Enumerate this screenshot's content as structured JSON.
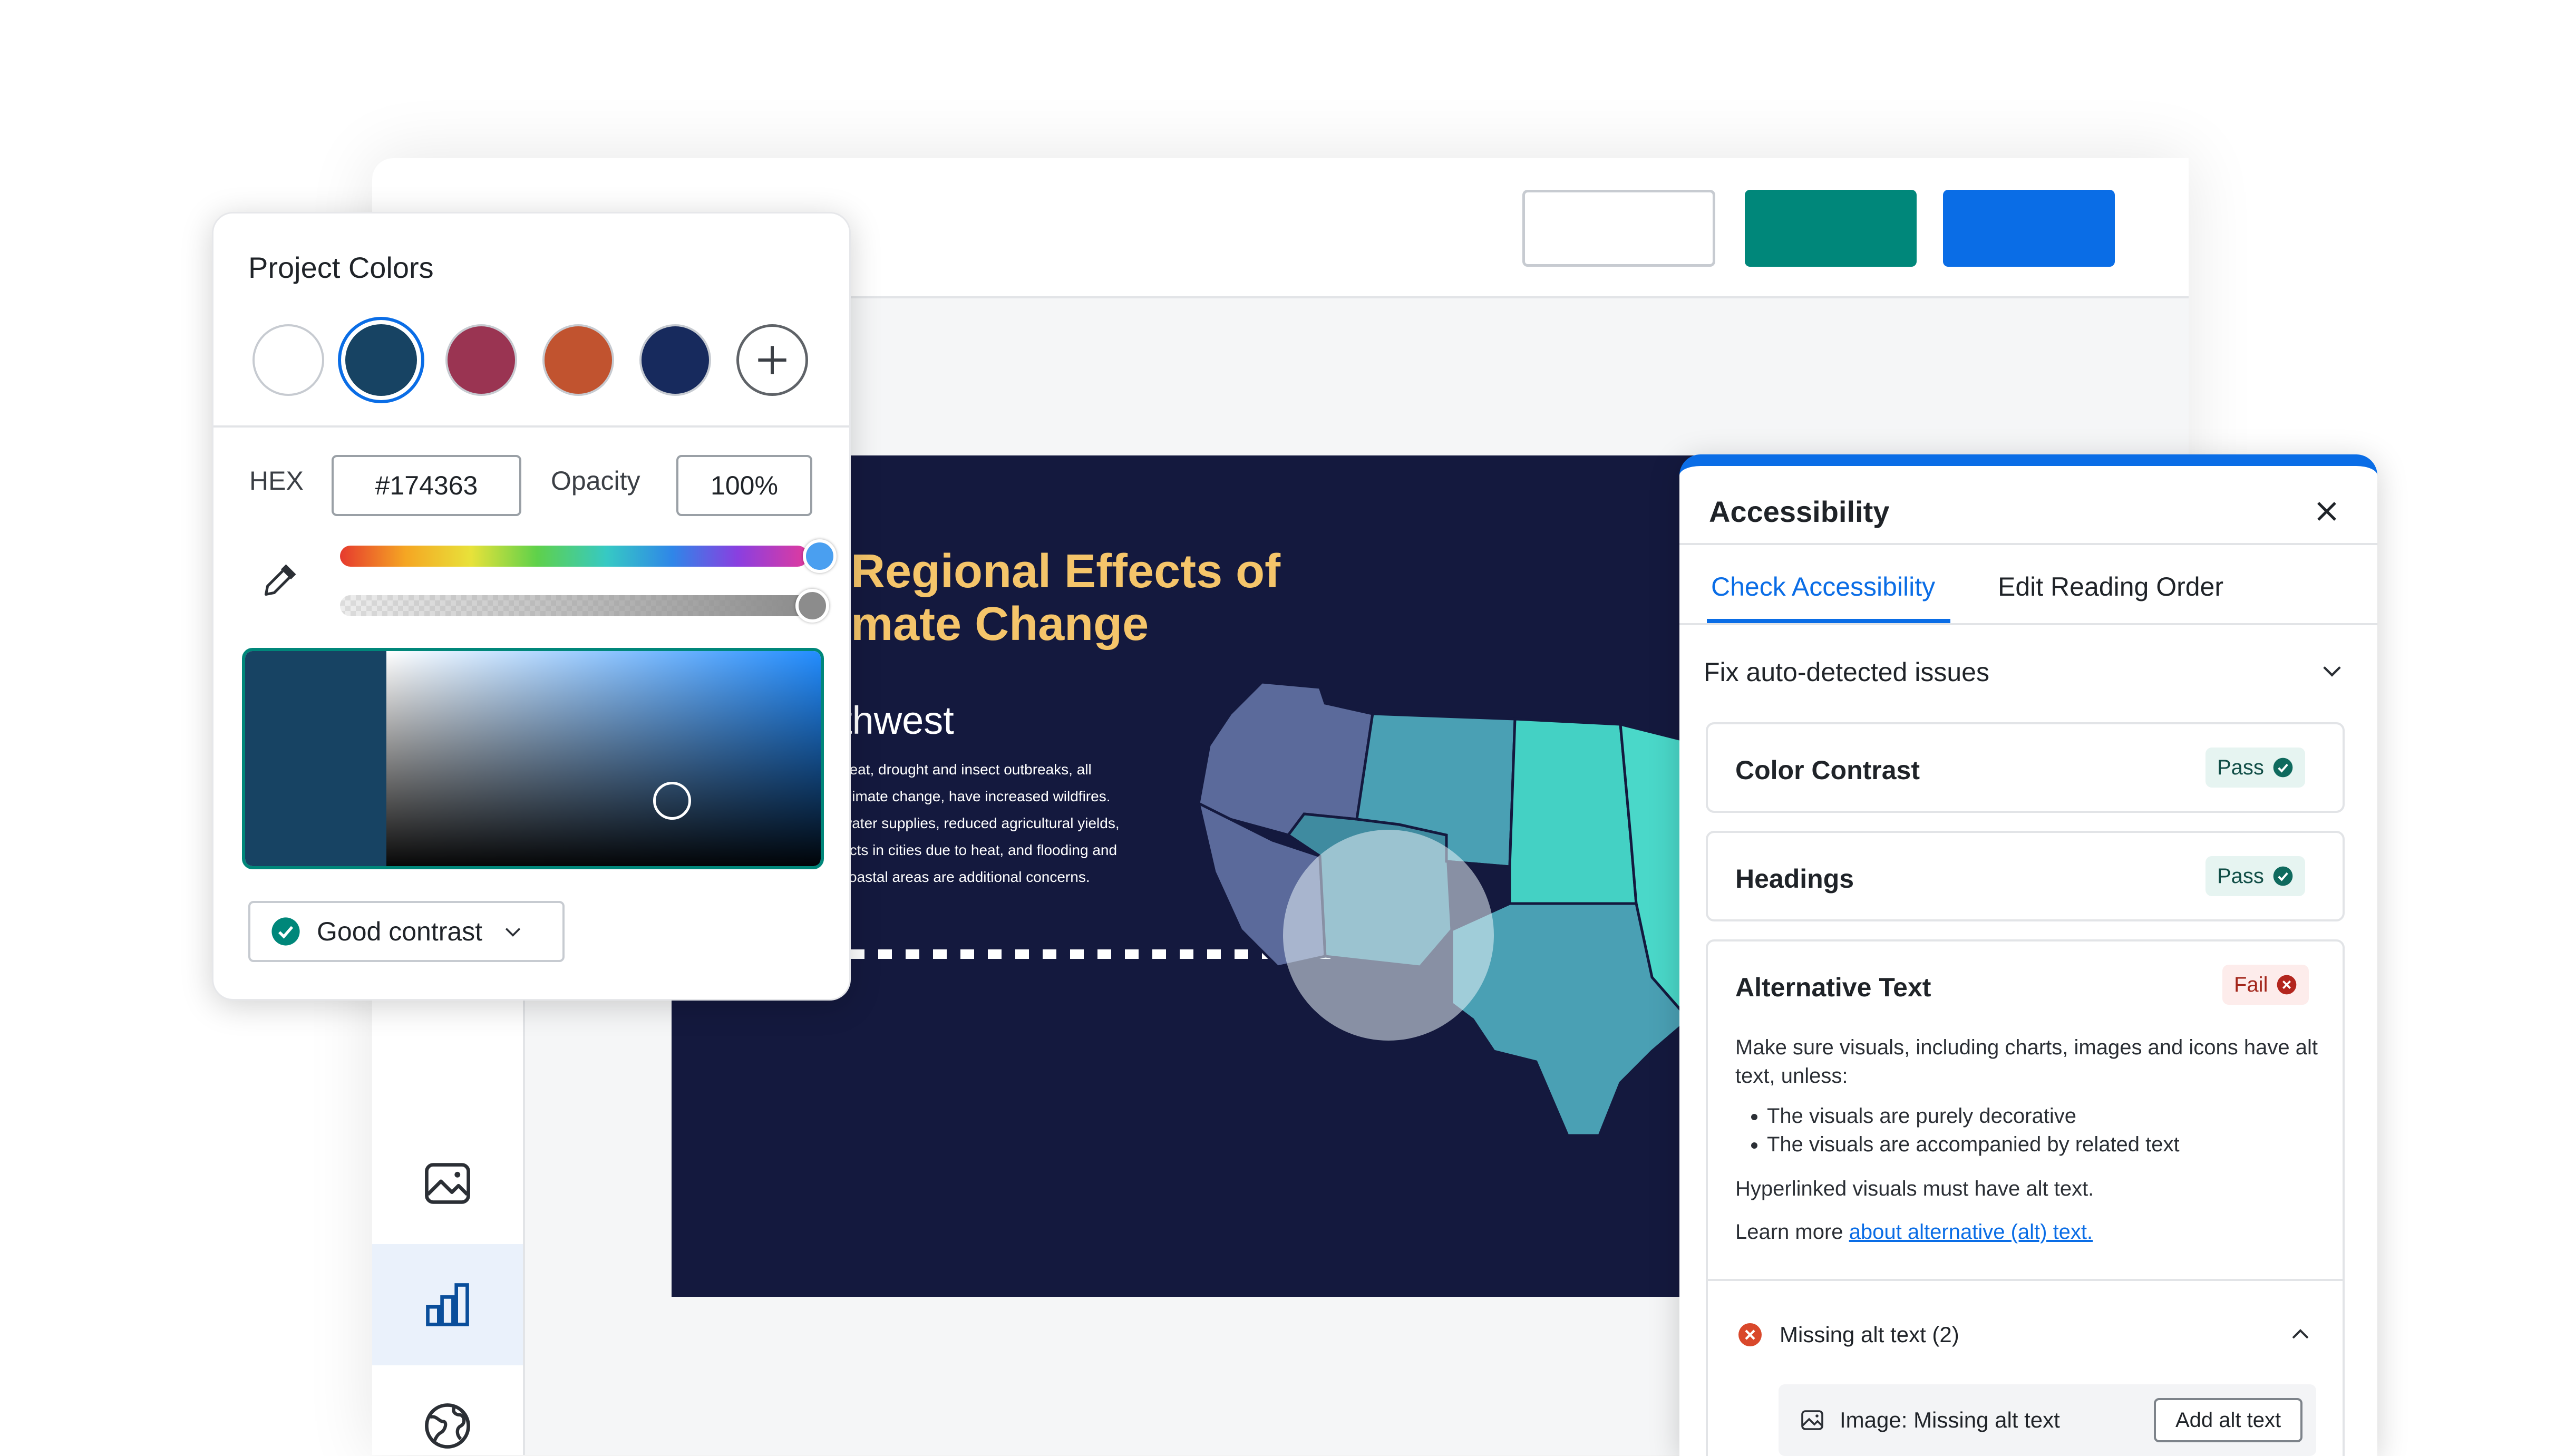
{
  "colors": {
    "teal": "#00877a",
    "blue": "#0a6de6",
    "slide_bg": "#14193e",
    "title_yellow": "#f5c56a"
  },
  "slide": {
    "title_line1": "Regional Effects of",
    "title_line2": "mate Change",
    "subtitle": "thwest",
    "body_lines": [
      "heat, drought and insect outbreaks, all",
      "climate change, have increased wildfires.",
      "water supplies, reduced agricultural yields,",
      "acts in cities due to heat, and flooding and",
      "coastal areas are additional concerns."
    ]
  },
  "rail": {
    "icons": [
      "image-icon",
      "bar-chart-icon",
      "globe-icon"
    ],
    "active_index": 1
  },
  "project_colors": {
    "title": "Project Colors",
    "swatches": [
      "#ffffff",
      "#174363",
      "#9a3452",
      "#c1532f",
      "#172a5d"
    ],
    "selected_index": 1,
    "hex_label": "HEX",
    "hex_value": "#174363",
    "opacity_label": "Opacity",
    "opacity_value": "100%",
    "hue_position": 0.85,
    "opacity_position": 1.0,
    "contrast_label": "Good contrast"
  },
  "accessibility": {
    "title": "Accessibility",
    "tabs": [
      "Check Accessibility",
      "Edit Reading Order"
    ],
    "active_tab": 0,
    "section_title": "Fix auto-detected issues",
    "checks": [
      {
        "name": "Color Contrast",
        "status": "Pass"
      },
      {
        "name": "Headings",
        "status": "Pass"
      },
      {
        "name": "Alternative Text",
        "status": "Fail"
      }
    ],
    "alt_text": {
      "intro": "Make sure visuals, including charts, images and icons have alt text, unless:",
      "bullets": [
        "The visuals are purely decorative",
        "The visuals are accompanied by related text"
      ],
      "hyperlink_note": "Hyperlinked visuals must have alt text.",
      "learn_more": "Learn more",
      "learn_link": "about alternative (alt) text."
    },
    "missing": {
      "label": "Missing alt text (2)",
      "item_label": "Image: Missing alt text",
      "button": "Add alt text"
    }
  }
}
